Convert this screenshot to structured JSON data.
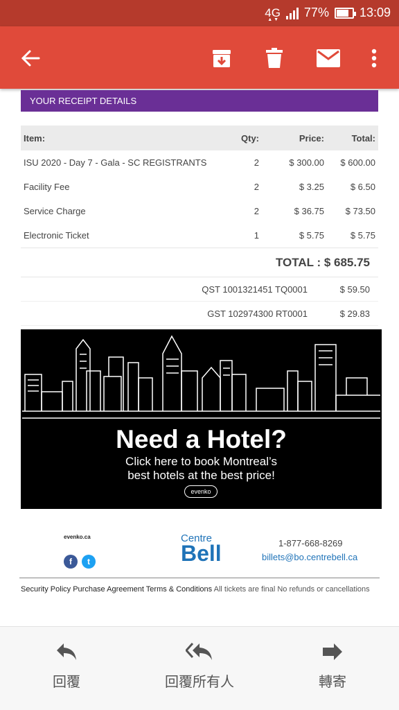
{
  "status_bar": {
    "network": "4G",
    "battery": "77%",
    "battery_level": 0.77,
    "time": "13:09"
  },
  "app_bar": {
    "icons": [
      "back-arrow-icon",
      "archive-icon",
      "trash-icon",
      "mail-icon",
      "more-vert-icon"
    ]
  },
  "receipt": {
    "header": "YOUR RECEIPT DETAILS",
    "columns": {
      "item": "Item:",
      "qty": "Qty:",
      "price": "Price:",
      "total": "Total:"
    },
    "rows": [
      {
        "item": "ISU 2020 - Day 7 - Gala - SC REGISTRANTS",
        "qty": "2",
        "price": "$ 300.00",
        "total": "$ 600.00"
      },
      {
        "item": "Facility Fee",
        "qty": "2",
        "price": "$ 3.25",
        "total": "$ 6.50"
      },
      {
        "item": "Service Charge",
        "qty": "2",
        "price": "$ 36.75",
        "total": "$ 73.50"
      },
      {
        "item": "Electronic Ticket",
        "qty": "1",
        "price": "$ 5.75",
        "total": "$ 5.75"
      }
    ],
    "total": "TOTAL : $ 685.75",
    "taxes": [
      {
        "label": "QST 1001321451 TQ0001",
        "value": "$ 59.50"
      },
      {
        "label": "GST 102974300 RT0001",
        "value": "$ 29.83"
      }
    ]
  },
  "banner": {
    "title": "Need a Hotel?",
    "line1": "Click here to book Montreal’s",
    "line2": "best hotels at the best price!",
    "logo": "evenko"
  },
  "footer": {
    "evenko": "evenko.ca",
    "social_icons": [
      "facebook-icon",
      "twitter-icon"
    ],
    "centre": "Centre",
    "bell": "Bell",
    "phone": "1-877-668-8269",
    "email": "billets@bo.centrebell.ca",
    "links": [
      "Security Policy",
      "Purchase Agreement",
      "Terms & Conditions"
    ],
    "notes": [
      "All tickets are final",
      "No refunds or cancellations"
    ]
  },
  "bottom_actions": [
    {
      "label": "回覆",
      "icon": "reply-icon"
    },
    {
      "label": "回覆所有人",
      "icon": "reply-all-icon"
    },
    {
      "label": "轉寄",
      "icon": "forward-icon"
    }
  ],
  "colors": {
    "status_bar": "#b53a2c",
    "app_bar": "#e04a3a",
    "receipt_header": "#6a2f96",
    "link": "#1f73b8"
  }
}
